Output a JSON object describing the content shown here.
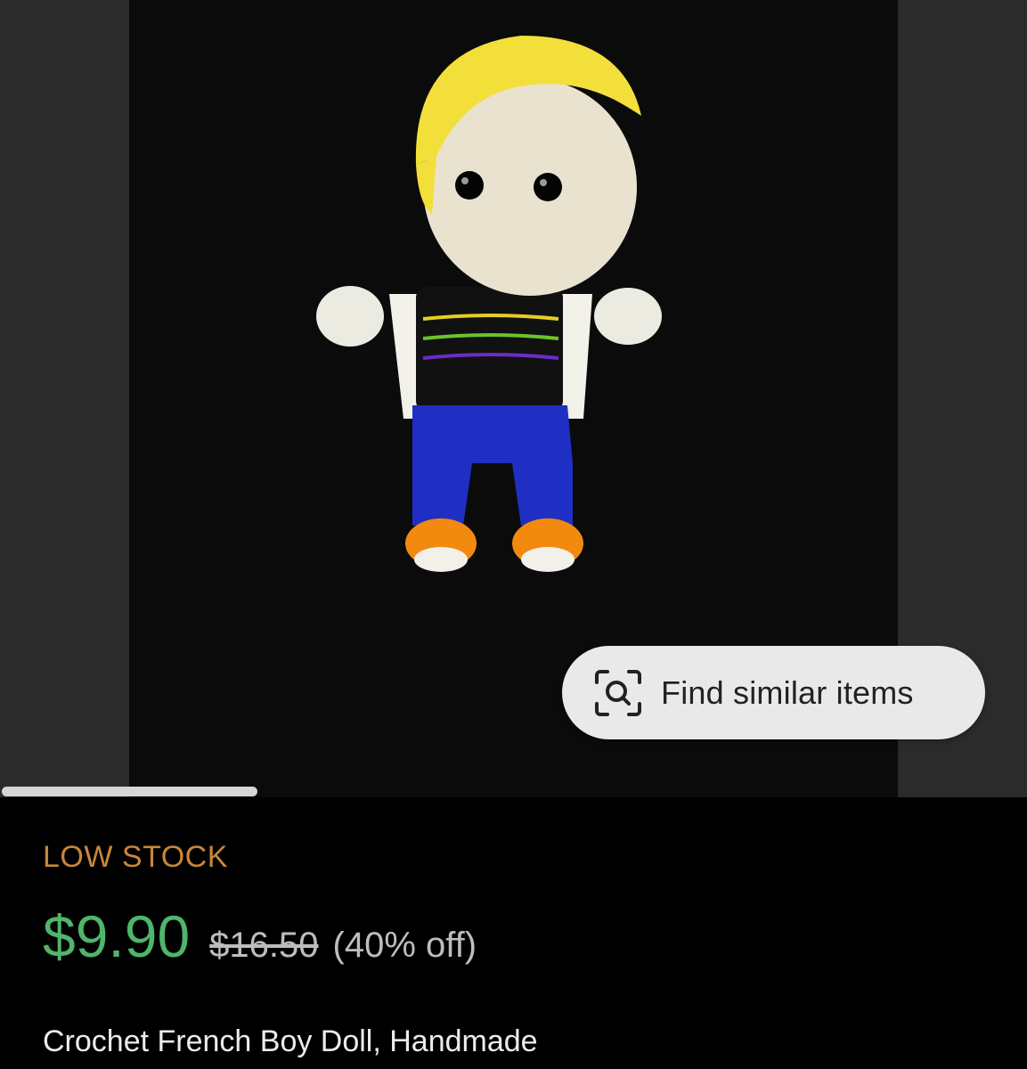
{
  "listing": {
    "image_alt": "Crocheted doll with yellow hair, black striped shirt, white jacket, blue pants and orange shoes",
    "find_similar_label": "Find similar items",
    "stock_status": "LOW STOCK",
    "price": "$9.90",
    "original_price": "$16.50",
    "discount": "(40% off)",
    "title": "Crochet French Boy Doll, Handmade"
  },
  "colors": {
    "price": "#4fb56b",
    "stock": "#c8863a",
    "button_bg": "#e9e9e9"
  },
  "icons": {
    "find_similar": "visual-search-icon"
  }
}
